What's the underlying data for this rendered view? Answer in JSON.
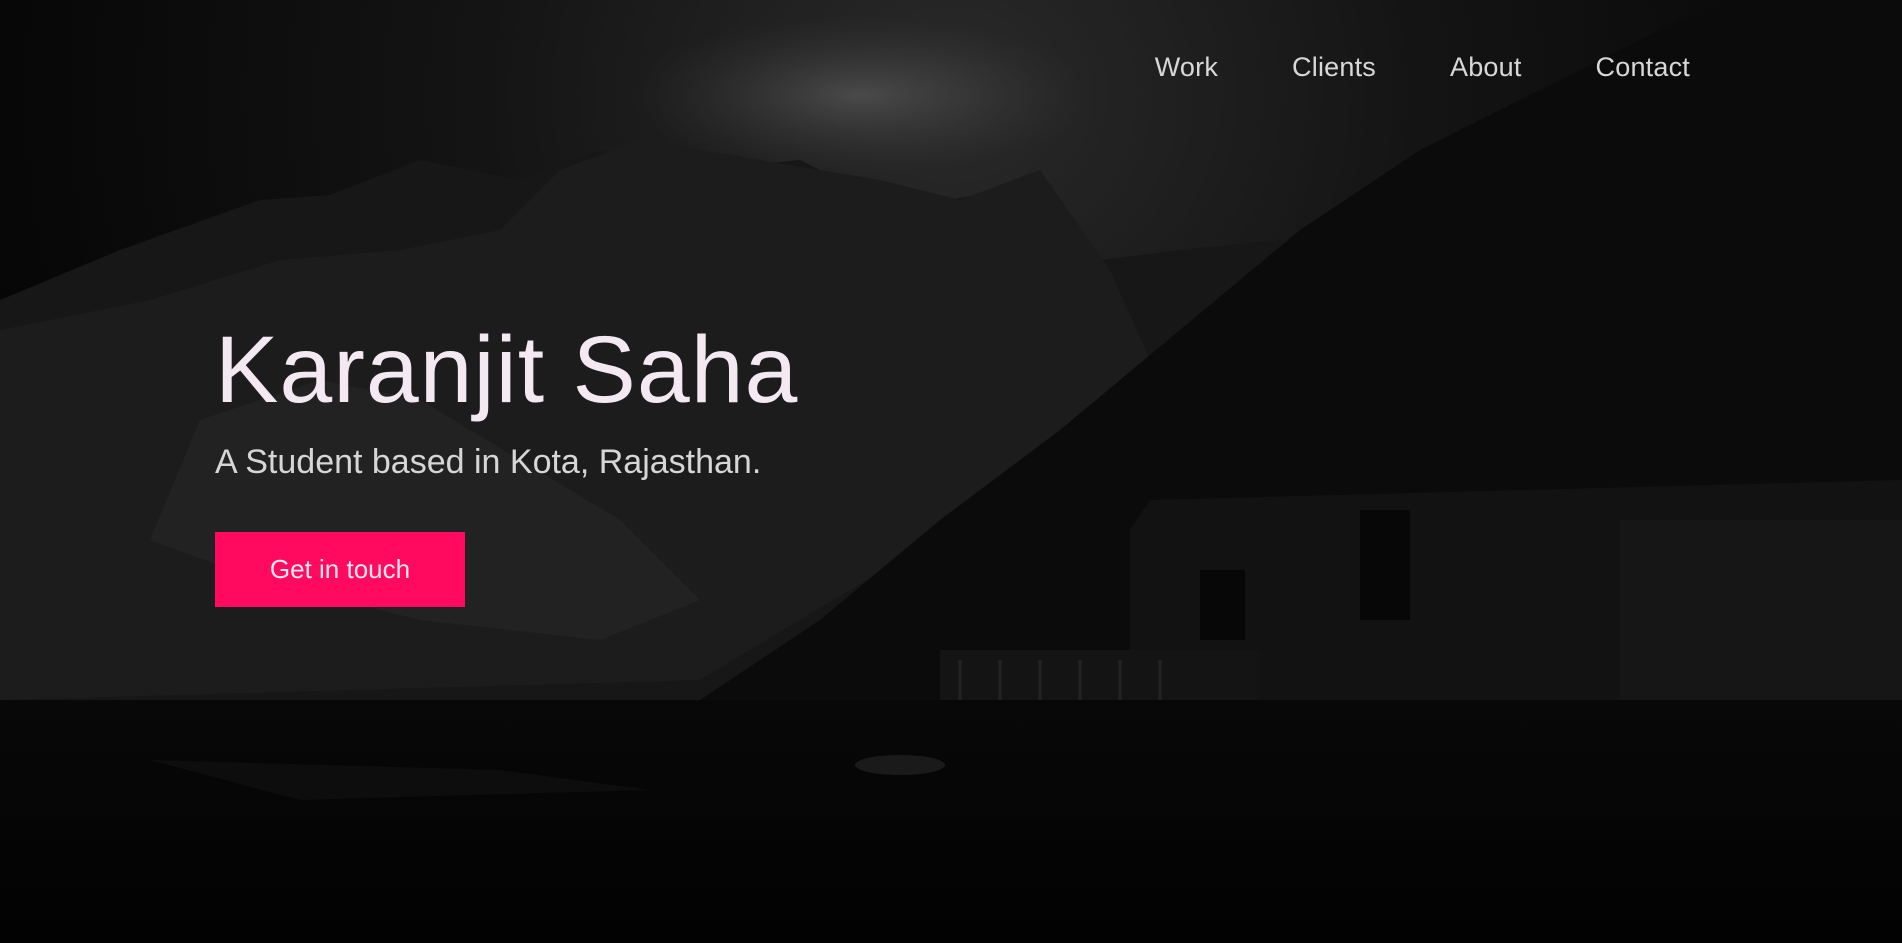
{
  "nav": {
    "items": [
      {
        "label": "Work"
      },
      {
        "label": "Clients"
      },
      {
        "label": "About"
      },
      {
        "label": "Contact"
      }
    ]
  },
  "hero": {
    "title": "Karanjit Saha",
    "subtitle": "A Student based in Kota, Rajasthan.",
    "cta_label": "Get in touch"
  },
  "colors": {
    "accent": "#ff0a5f",
    "background": "#0a0a0a",
    "title_text": "#f4e9f2",
    "body_text": "#d6d6d6"
  }
}
